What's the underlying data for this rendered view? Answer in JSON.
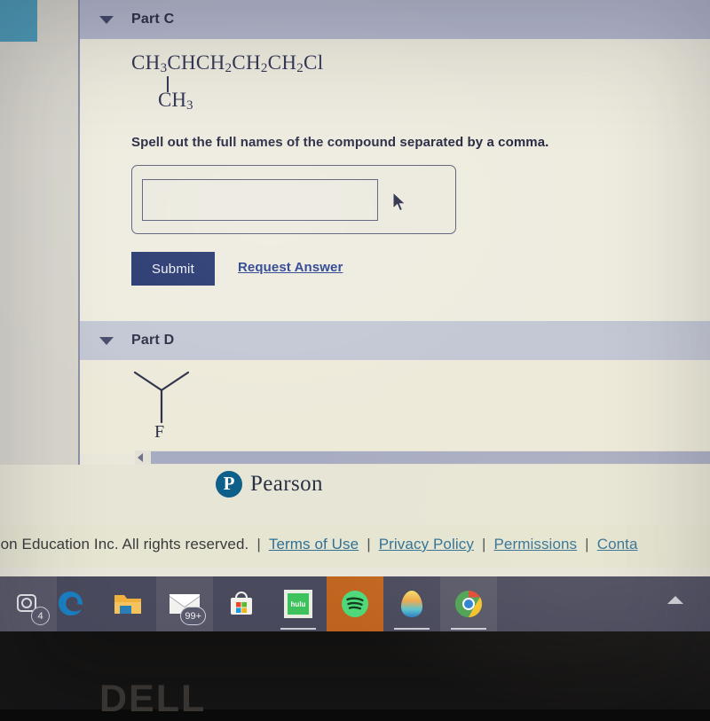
{
  "partC": {
    "label": "Part C",
    "toggle_icon": "chevron-down-icon",
    "formula_main": "CH3CHCH2CH2CH2Cl",
    "formula_branch": "CH3",
    "instruction": "Spell out the full names of the compound separated by a comma.",
    "answer_value": "",
    "answer_placeholder": "",
    "submit_label": "Submit",
    "request_answer_label": "Request Answer"
  },
  "partD": {
    "label": "Part D",
    "toggle_icon": "chevron-down-icon",
    "structure_atom_label": "F",
    "structure_type": "skeletal-y-shape"
  },
  "branding": {
    "logo_letter": "P",
    "wordmark": "Pearson"
  },
  "footer": {
    "copyright": "son Education Inc. All rights reserved.",
    "separator": "|",
    "links": [
      "Terms of Use",
      "Privacy Policy",
      "Permissions",
      "Conta"
    ]
  },
  "scrollbar": {
    "left_arrow_icon": "caret-left-icon"
  },
  "taskbar": {
    "items": [
      {
        "name": "cortana-camera-icon",
        "badge": "4"
      },
      {
        "name": "edge-browser-icon",
        "badge": ""
      },
      {
        "name": "file-explorer-icon",
        "badge": ""
      },
      {
        "name": "mail-icon",
        "badge": "99+"
      },
      {
        "name": "microsoft-store-icon",
        "badge": ""
      },
      {
        "name": "hulu-icon",
        "badge": ""
      },
      {
        "name": "spotify-icon",
        "badge": ""
      },
      {
        "name": "egg-app-icon",
        "badge": ""
      },
      {
        "name": "chrome-icon",
        "badge": ""
      }
    ],
    "tray_chevron_icon": "chevron-up-icon"
  },
  "device": {
    "brand": "DELL"
  },
  "colors": {
    "part_c_bar": "#b3b7cd",
    "part_d_bar": "#c3c7d4",
    "submit_bg": "#26376f",
    "link": "#27408f",
    "footer_link": "#2f6f96",
    "page_bg": "#eeebdf",
    "taskbar_bg": "#4a4a5e"
  }
}
